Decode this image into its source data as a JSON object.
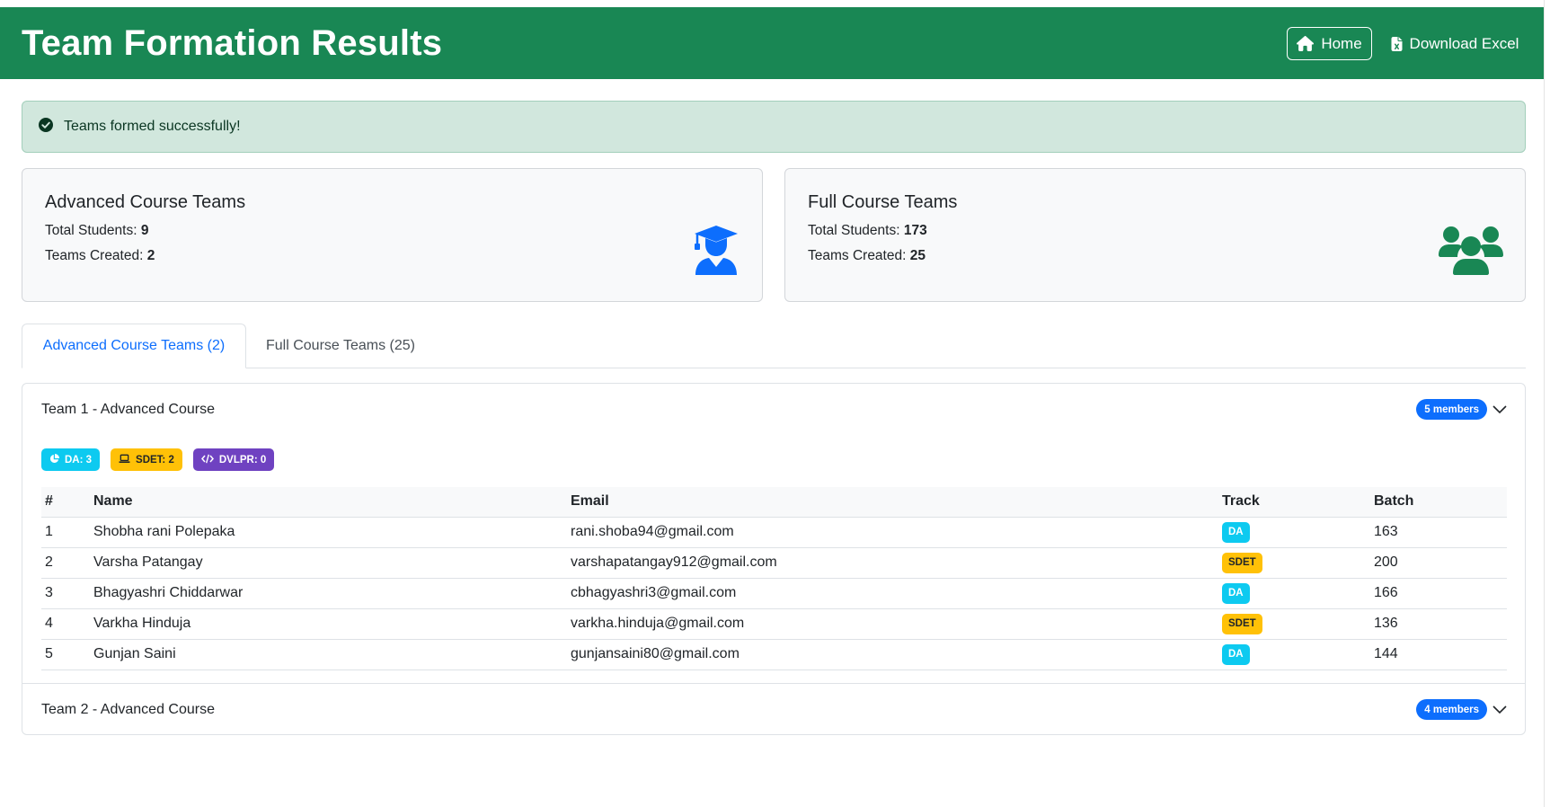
{
  "header": {
    "title": "Team Formation Results",
    "home_label": "Home",
    "download_label": "Download Excel",
    "color": "#198754"
  },
  "alert": {
    "message": "Teams formed successfully!"
  },
  "summary": {
    "advanced": {
      "title": "Advanced Course Teams",
      "students_label": "Total Students: ",
      "students_value": "9",
      "teams_label": "Teams Created: ",
      "teams_value": "2",
      "icon": "graduate-icon"
    },
    "full": {
      "title": "Full Course Teams",
      "students_label": "Total Students: ",
      "students_value": "173",
      "teams_label": "Teams Created: ",
      "teams_value": "25",
      "icon": "users-icon"
    }
  },
  "tabs": [
    {
      "label": "Advanced Course Teams (2)",
      "active": true
    },
    {
      "label": "Full Course Teams (25)",
      "active": false
    }
  ],
  "teams": [
    {
      "title": "Team 1 - Advanced Course",
      "members_badge": "5 members",
      "expanded": true,
      "track_counts": [
        {
          "label": "DA: 3",
          "icon": "chart-pie-icon"
        },
        {
          "label": "SDET: 2",
          "icon": "laptop-icon"
        },
        {
          "label": "DVLPR: 0",
          "icon": "code-icon"
        }
      ],
      "columns": [
        "#",
        "Name",
        "Email",
        "Track",
        "Batch"
      ],
      "rows": [
        {
          "num": "1",
          "name": "Shobha rani Polepaka",
          "email": "rani.shoba94@gmail.com",
          "track": "DA",
          "batch": "163"
        },
        {
          "num": "2",
          "name": "Varsha Patangay",
          "email": "varshapatangay912@gmail.com",
          "track": "SDET",
          "batch": "200"
        },
        {
          "num": "3",
          "name": "Bhagyashri Chiddarwar",
          "email": "cbhagyashri3@gmail.com",
          "track": "DA",
          "batch": "166"
        },
        {
          "num": "4",
          "name": "Varkha Hinduja",
          "email": "varkha.hinduja@gmail.com",
          "track": "SDET",
          "batch": "136"
        },
        {
          "num": "5",
          "name": "Gunjan Saini",
          "email": "gunjansaini80@gmail.com",
          "track": "DA",
          "batch": "144"
        }
      ]
    },
    {
      "title": "Team 2 - Advanced Course",
      "members_badge": "4 members",
      "expanded": false
    }
  ],
  "colors": {
    "da": "#0dcaf0",
    "sdet": "#ffc107",
    "dvlpr": "#6f42c1",
    "primary": "#0d6efd",
    "success_bg": "#d1e7dd"
  }
}
